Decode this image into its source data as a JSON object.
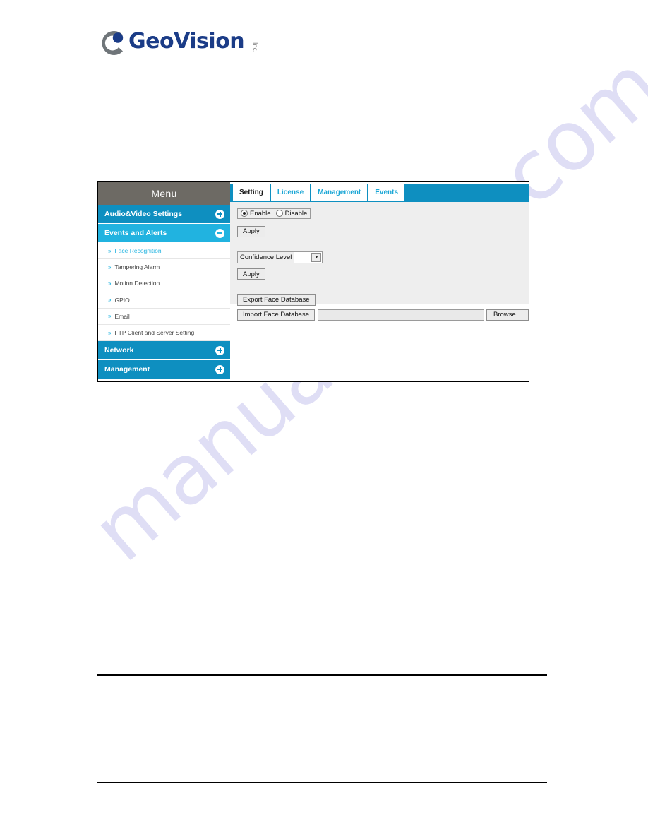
{
  "brand": {
    "logo_text": "GeoVision",
    "logo_tm": "Inc.",
    "logo_icon": "geovision-c-logo"
  },
  "watermark": {
    "text": "manualshive.com"
  },
  "menu": {
    "header": "Menu",
    "groups": [
      {
        "label": "Audio&Video Settings",
        "state": "collapsed",
        "toggle_icon": "plus-circle-icon"
      },
      {
        "label": "Events and Alerts",
        "state": "expanded",
        "toggle_icon": "minus-circle-icon",
        "items": [
          {
            "label": "Face Recognition",
            "active": true
          },
          {
            "label": "Tampering Alarm",
            "active": false
          },
          {
            "label": "Motion Detection",
            "active": false
          },
          {
            "label": "GPIO",
            "active": false
          },
          {
            "label": "Email",
            "active": false
          },
          {
            "label": "FTP Client and Server Setting",
            "active": false
          }
        ]
      },
      {
        "label": "Network",
        "state": "collapsed",
        "toggle_icon": "plus-circle-icon"
      },
      {
        "label": "Management",
        "state": "collapsed",
        "toggle_icon": "plus-circle-icon"
      }
    ]
  },
  "tabs": [
    {
      "label": "Setting",
      "active": true
    },
    {
      "label": "License",
      "active": false
    },
    {
      "label": "Management",
      "active": false
    },
    {
      "label": "Events",
      "active": false
    }
  ],
  "form": {
    "enable_option": "Enable",
    "disable_option": "Disable",
    "selected_state": "Enable",
    "apply_button_1": "Apply",
    "confidence_label": "Confidence Level",
    "confidence_value": "",
    "confidence_arrow": "chevron-down-icon",
    "apply_button_2": "Apply",
    "export_button": "Export Face Database",
    "import_button": "Import Face Database",
    "import_path_value": "",
    "browse_button": "Browse..."
  },
  "colors": {
    "brand_blue": "#0e8fc0",
    "accent_cyan": "#21b3e0",
    "menu_header_gray": "#6d6a64",
    "logo_navy": "#1b3c87",
    "watermark_lavender": "#cdcaf0"
  }
}
